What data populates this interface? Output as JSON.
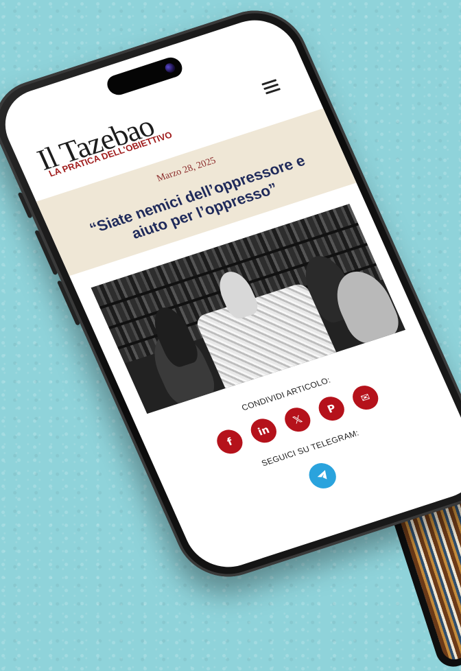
{
  "site": {
    "logo_main": "Il Tazebao",
    "logo_sub": "LA PRATICA DELL'OBIETTIVO"
  },
  "menu": {
    "icon": "hamburger-menu-icon"
  },
  "post": {
    "date": "Marzo 28, 2025",
    "title": "“Siate nemici dell’oppressore e aiuto per l’oppresso”"
  },
  "photo": {
    "alt_icon": "article-photo"
  },
  "share": {
    "label": "CONDIVIDI ARTICOLO:",
    "icons": [
      {
        "name": "facebook",
        "glyph": "f"
      },
      {
        "name": "linkedin",
        "glyph": "in"
      },
      {
        "name": "x",
        "glyph": "𝕏"
      },
      {
        "name": "pinterest",
        "glyph": "P"
      },
      {
        "name": "email",
        "glyph": "✉"
      }
    ]
  },
  "telegram": {
    "label": "SEGUICI SU TELEGRAM:"
  },
  "colors": {
    "accent_red": "#b5121b",
    "title_blue": "#1f2a5a",
    "band": "#efe7d6",
    "telegram": "#2aa3dd",
    "background": "#8fd3da"
  }
}
